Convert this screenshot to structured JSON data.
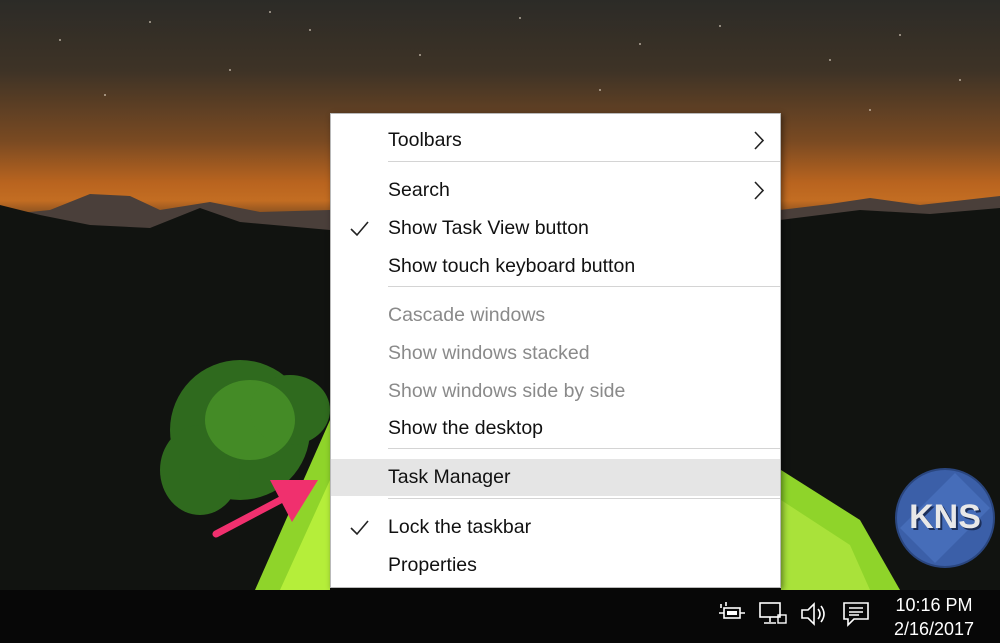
{
  "context_menu": {
    "items": [
      {
        "label": "Toolbars",
        "checked": false,
        "disabled": false,
        "submenu": true
      },
      {
        "label": "Search",
        "checked": false,
        "disabled": false,
        "submenu": true
      },
      {
        "label": "Show Task View button",
        "checked": true,
        "disabled": false,
        "submenu": false
      },
      {
        "label": "Show touch keyboard button",
        "checked": false,
        "disabled": false,
        "submenu": false
      },
      {
        "label": "Cascade windows",
        "checked": false,
        "disabled": true,
        "submenu": false
      },
      {
        "label": "Show windows stacked",
        "checked": false,
        "disabled": true,
        "submenu": false
      },
      {
        "label": "Show windows side by side",
        "checked": false,
        "disabled": true,
        "submenu": false
      },
      {
        "label": "Show the desktop",
        "checked": false,
        "disabled": false,
        "submenu": false
      },
      {
        "label": "Task Manager",
        "checked": false,
        "disabled": false,
        "submenu": false,
        "highlighted": true
      },
      {
        "label": "Lock the taskbar",
        "checked": true,
        "disabled": false,
        "submenu": false
      },
      {
        "label": "Properties",
        "checked": false,
        "disabled": false,
        "submenu": false
      }
    ],
    "highlight_color": "#e5e5e5",
    "disabled_text_color": "#8a8a8a"
  },
  "taskbar": {
    "tray_icons": [
      "power-plug-icon",
      "network-icon",
      "volume-icon",
      "action-center-icon"
    ],
    "clock": {
      "time": "10:16 PM",
      "date": "2/16/2017"
    }
  },
  "overlay": {
    "watermark_text": "KNS",
    "arrow_color": "#f0306e"
  }
}
